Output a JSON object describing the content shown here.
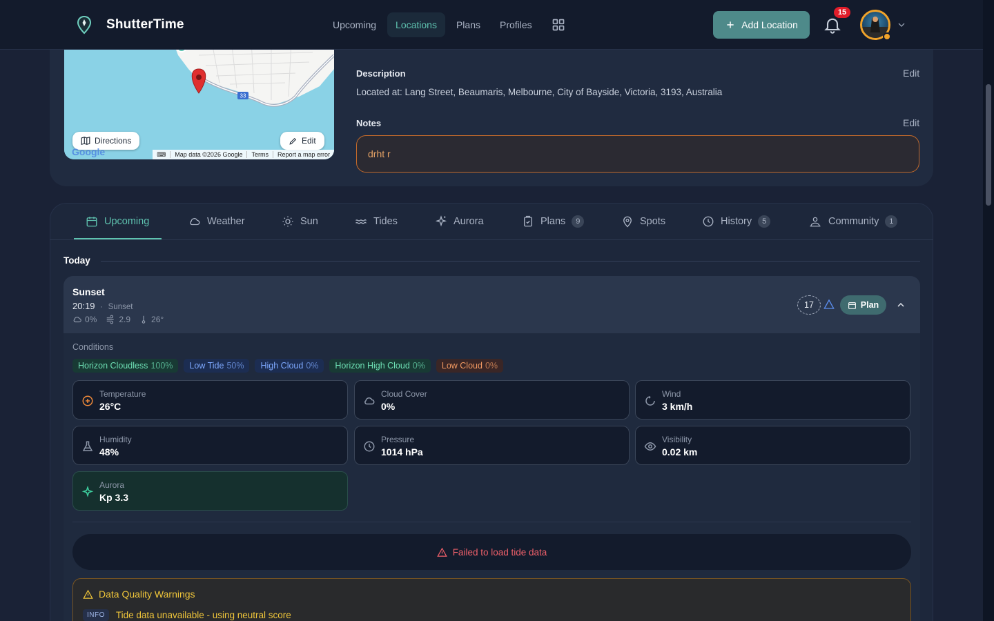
{
  "header": {
    "brand": "ShutterTime",
    "nav": [
      "Upcoming",
      "Locations",
      "Plans",
      "Profiles"
    ],
    "active_nav": "Locations",
    "add_location": "Add Location",
    "notification_count": "15",
    "accent": "#5fc3b0"
  },
  "map": {
    "directions": "Directions",
    "edit": "Edit",
    "route_badge": "33",
    "attribution": [
      "Map data ©2026 Google",
      "Terms",
      "Report a map error"
    ],
    "google": "Google"
  },
  "details": {
    "description_label": "Description",
    "description_edit": "Edit",
    "description_text": "Located at: Lang Street, Beaumaris, Melbourne, City of Bayside, Victoria, 3193, Australia",
    "notes_label": "Notes",
    "notes_edit": "Edit",
    "notes_text": "drht r"
  },
  "tabs": [
    {
      "label": "Upcoming",
      "icon": "calendar-icon"
    },
    {
      "label": "Weather",
      "icon": "cloud-icon"
    },
    {
      "label": "Sun",
      "icon": "sun-icon"
    },
    {
      "label": "Tides",
      "icon": "waves-icon"
    },
    {
      "label": "Aurora",
      "icon": "sparkles-icon"
    },
    {
      "label": "Plans",
      "icon": "clipboard-icon",
      "count": "9"
    },
    {
      "label": "Spots",
      "icon": "map-pin-icon"
    },
    {
      "label": "History",
      "icon": "clock-icon",
      "count": "5"
    },
    {
      "label": "Community",
      "icon": "community-icon",
      "count": "1"
    }
  ],
  "today": {
    "label": "Today",
    "event": {
      "title": "Sunset",
      "time": "20:19",
      "type": "Sunset",
      "cloud": "0%",
      "wind": "2.9",
      "temp": "26°",
      "score": "17",
      "plan": "Plan"
    },
    "conditions_label": "Conditions",
    "chips": [
      {
        "label": "Horizon Cloudless",
        "pct": "100%",
        "tone": "green"
      },
      {
        "label": "Low Tide",
        "pct": "50%",
        "tone": "blue"
      },
      {
        "label": "High Cloud",
        "pct": "0%",
        "tone": "blue"
      },
      {
        "label": "Horizon High Cloud",
        "pct": "0%",
        "tone": "green"
      },
      {
        "label": "Low Cloud",
        "pct": "0%",
        "tone": "orange"
      }
    ],
    "metrics": [
      {
        "label": "Temperature",
        "value": "26°C",
        "icon": "thermometer-circle-icon"
      },
      {
        "label": "Cloud Cover",
        "value": "0%",
        "icon": "cloud-icon"
      },
      {
        "label": "Wind",
        "value": "3 km/h",
        "icon": "wind-icon"
      },
      {
        "label": "Humidity",
        "value": "48%",
        "icon": "flask-icon"
      },
      {
        "label": "Pressure",
        "value": "1014 hPa",
        "icon": "gauge-icon"
      },
      {
        "label": "Visibility",
        "value": "0.02 km",
        "icon": "eye-icon"
      },
      {
        "label": "Aurora",
        "value": "Kp 3.3",
        "icon": "sparkles-icon"
      }
    ],
    "tide_error": "Failed to load tide data",
    "warnings_title": "Data Quality Warnings",
    "warning_tag": "INFO",
    "warning_text": "Tide data unavailable - using neutral score"
  }
}
